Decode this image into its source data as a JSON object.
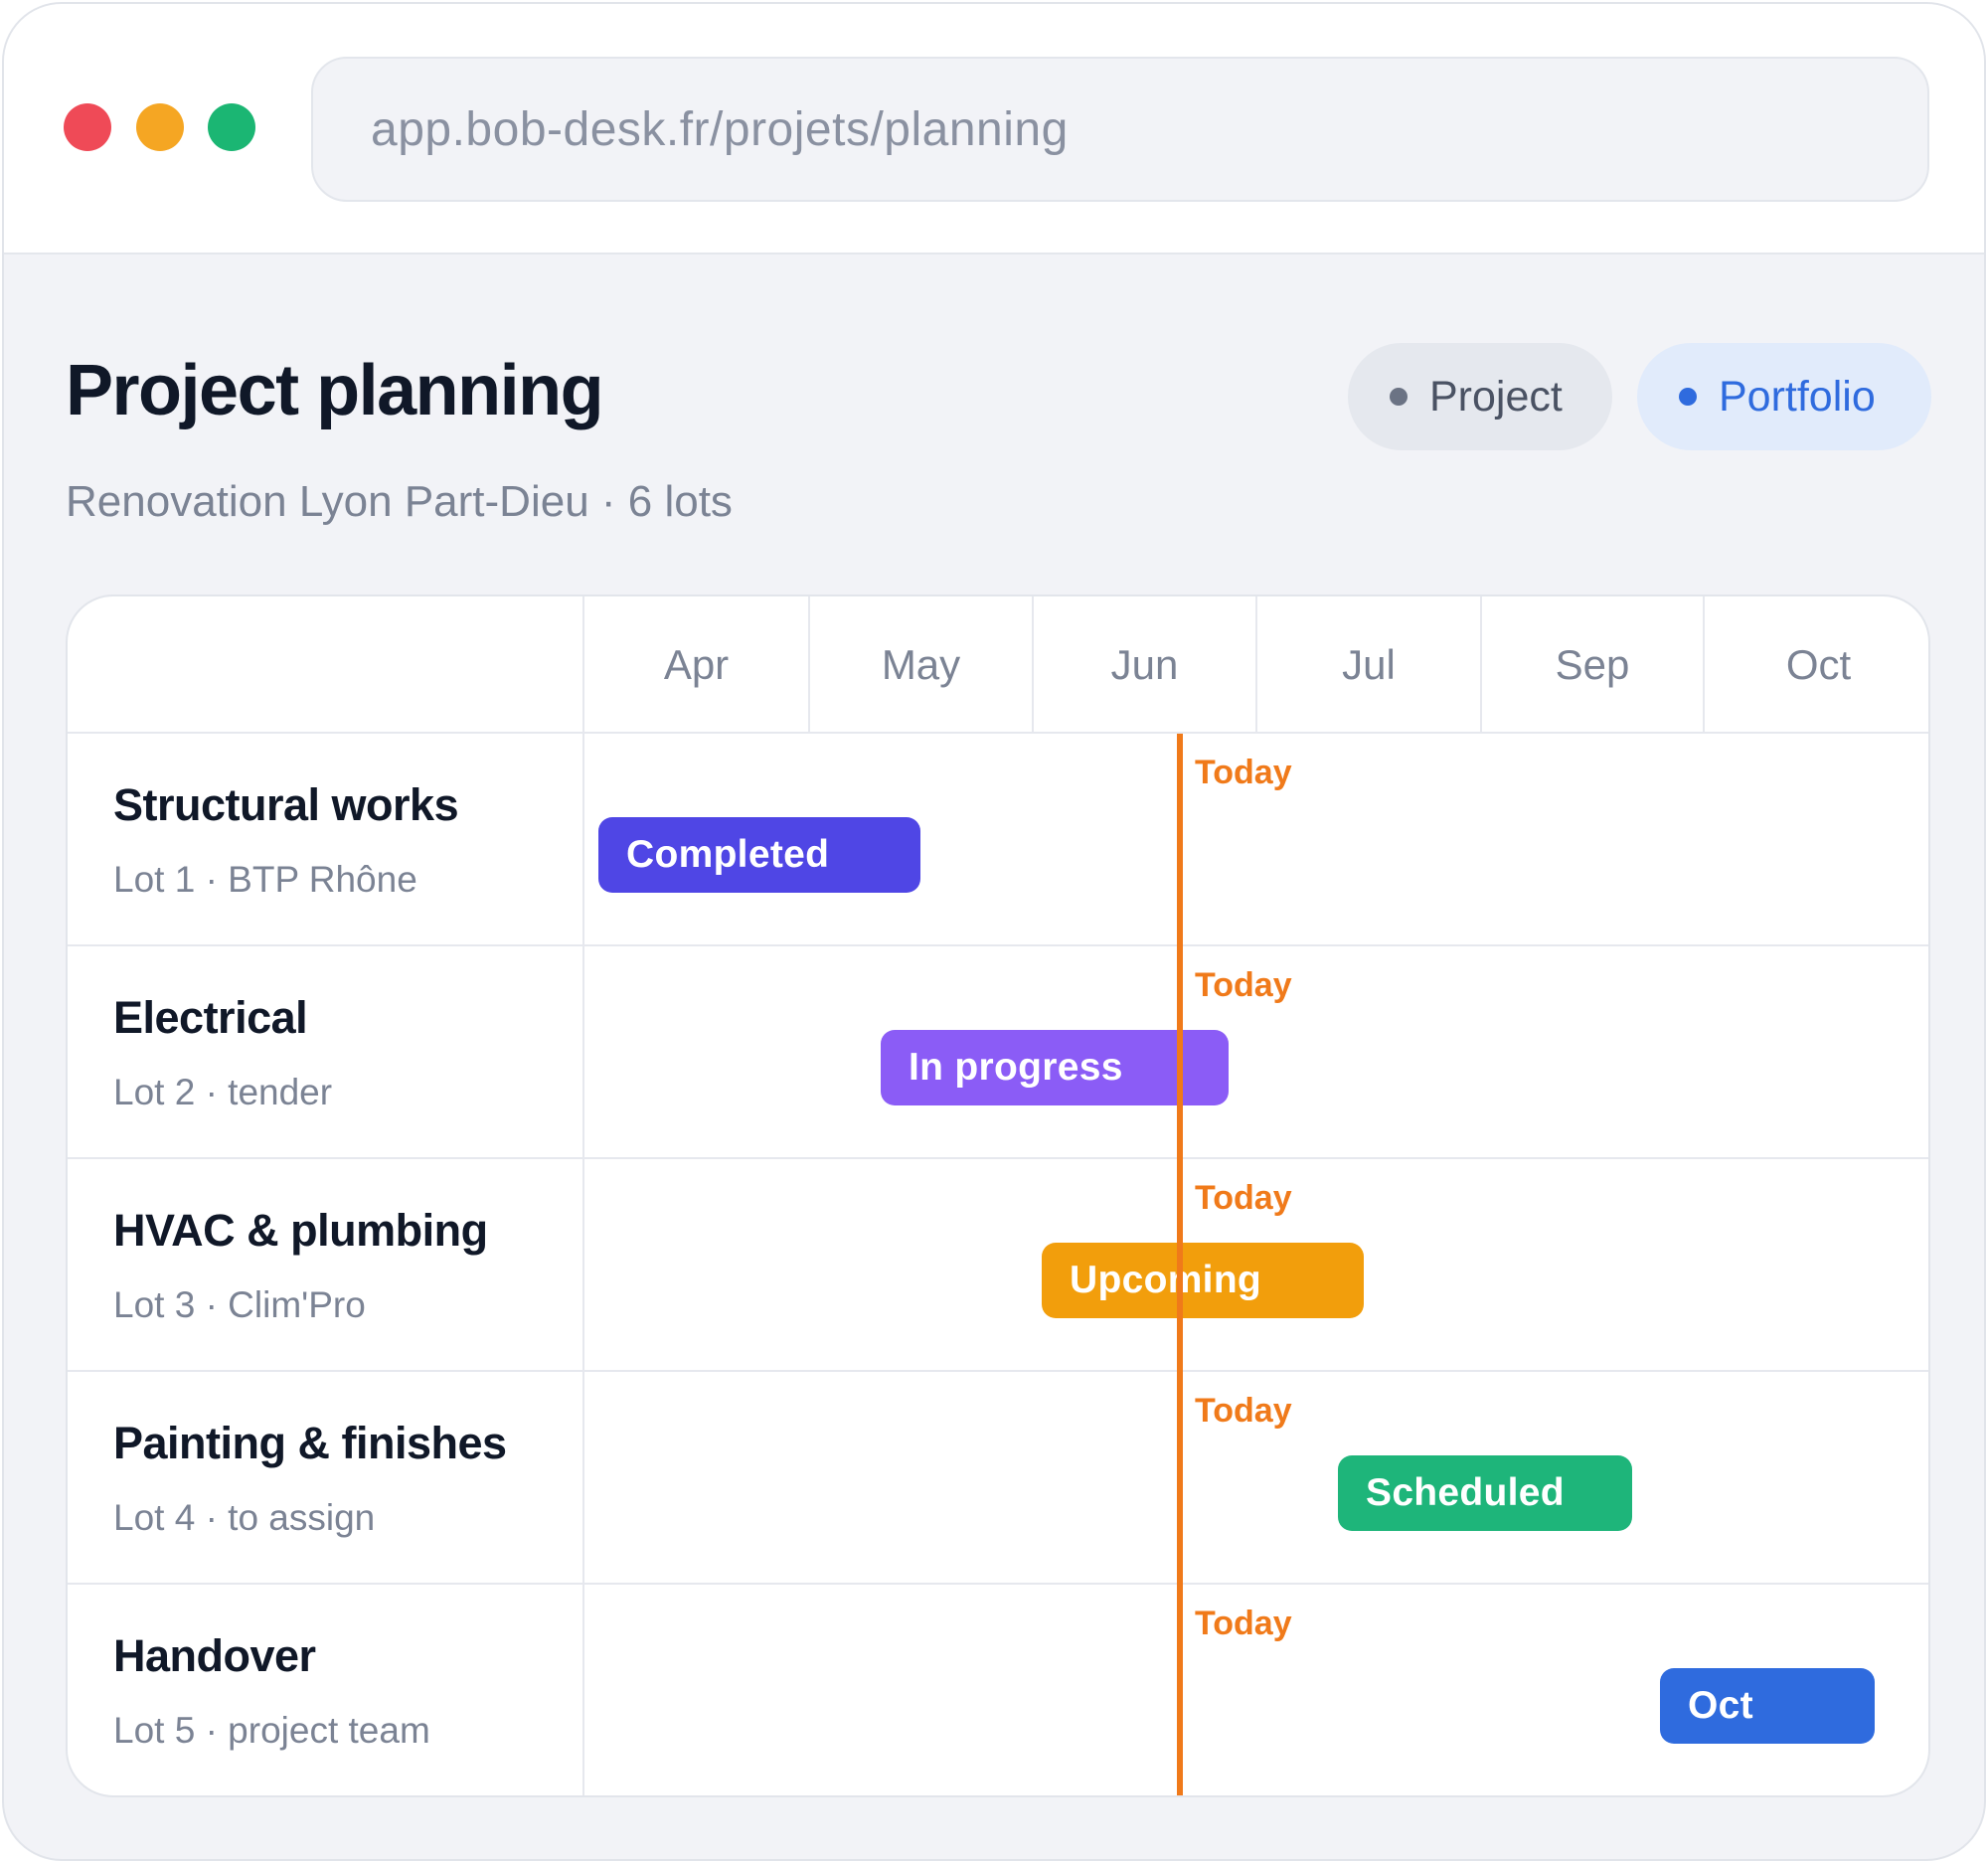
{
  "browser": {
    "url": "app.bob-desk.fr/projets/planning"
  },
  "page": {
    "title": "Project planning",
    "subtitle": "Renovation Lyon Part-Dieu · 6 lots",
    "view_toggle": [
      {
        "label": "Project",
        "active": false
      },
      {
        "label": "Portfolio",
        "active": true
      }
    ]
  },
  "gantt": {
    "months": [
      "Apr",
      "May",
      "Jun",
      "Jul",
      "Sep",
      "Oct"
    ],
    "today_label": "Today",
    "rows": [
      {
        "title": "Structural works",
        "sub": "Lot 1 · BTP Rhône",
        "bar": "Completed",
        "color": "#4f46e5"
      },
      {
        "title": "Electrical",
        "sub": "Lot 2 · tender",
        "bar": "In progress",
        "color": "#8b5cf6"
      },
      {
        "title": "HVAC & plumbing",
        "sub": "Lot 3 · Clim'Pro",
        "bar": "Upcoming",
        "color": "#f29e0c"
      },
      {
        "title": "Painting & finishes",
        "sub": "Lot 4 · to assign",
        "bar": "Scheduled",
        "color": "#1eb57a"
      },
      {
        "title": "Handover",
        "sub": "Lot 5 · project team",
        "bar": "Oct",
        "color": "#2f6bde"
      }
    ]
  },
  "colors": {
    "today": "#f07a1a",
    "window_dots": [
      "#ef4a57",
      "#f5a623",
      "#1bb673"
    ]
  }
}
